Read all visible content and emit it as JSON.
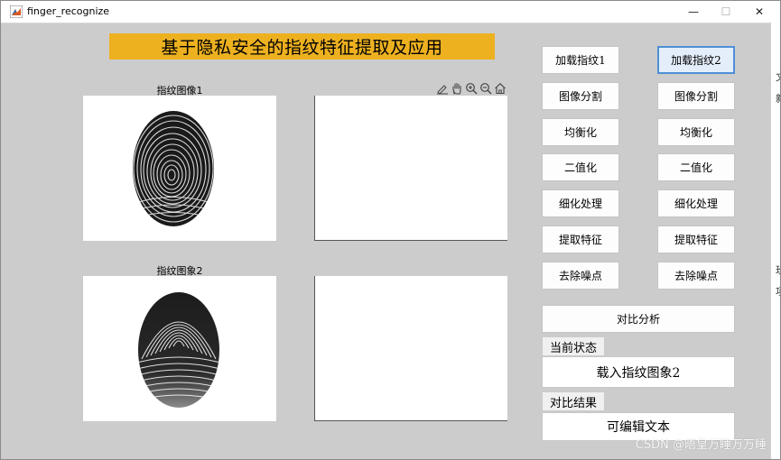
{
  "window": {
    "title": "finger_recognize",
    "minimize_glyph": "—",
    "maximize_glyph": "☐",
    "close_glyph": "✕"
  },
  "banner": {
    "title": "基于隐私安全的指纹特征提取及应用"
  },
  "axes": {
    "image1_title": "指纹图像1",
    "image2_title": "指纹图象2"
  },
  "toolbar": {
    "icons": [
      "brush-icon",
      "pan-hand-icon",
      "zoom-in-icon",
      "zoom-out-icon",
      "home-icon"
    ]
  },
  "buttons": {
    "col1": [
      "加载指纹1",
      "图像分割",
      "均衡化",
      "二值化",
      "细化处理",
      "提取特征",
      "去除噪点"
    ],
    "col2": [
      "加载指纹2",
      "图像分割",
      "均衡化",
      "二值化",
      "细化处理",
      "提取特征",
      "去除噪点"
    ],
    "compare": "对比分析"
  },
  "status": {
    "label": "当前状态",
    "value": "载入指纹图象2"
  },
  "result": {
    "label": "对比结果",
    "value": "可编辑文本"
  },
  "edge_text": [
    "文",
    "新",
    "玫",
    "项"
  ],
  "watermark": "CSDN @晤皇万睡万万睡",
  "colors": {
    "figure_background": "#cccccc",
    "banner_background": "#edb120",
    "focus_border": "#4f8fd6"
  }
}
